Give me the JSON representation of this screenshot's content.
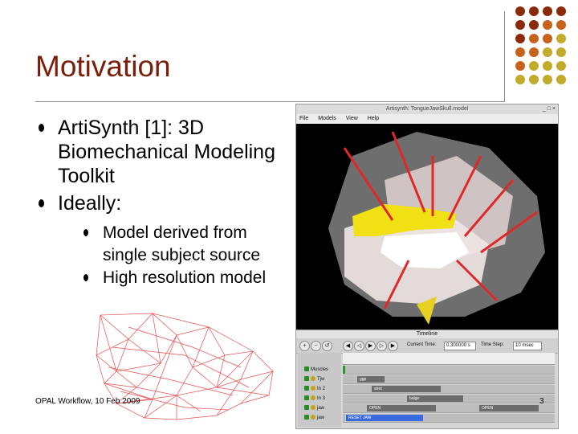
{
  "slide": {
    "title": "Motivation",
    "bullets": [
      {
        "text": "ArtiSynth [1]: 3D Biomechanical Modeling Toolkit"
      },
      {
        "text": "Ideally:",
        "sub": [
          "Model derived from single subject source",
          "High resolution model"
        ]
      }
    ],
    "footer": "OPAL Workflow, 10 Feb 2009",
    "page_number": "3"
  },
  "app_window": {
    "title": "Artisynth: TongueJawSkull.model",
    "menu": [
      "File",
      "Models",
      "View",
      "Help"
    ]
  },
  "timeline": {
    "title": "Timeline",
    "current_time_label": "Current Time:",
    "current_time_value": "0.300000 s",
    "time_step_label": "Time Step:",
    "time_step_value": "10 msec",
    "tracks": [
      "Muscles",
      "Tjw",
      "In 2",
      "In 3",
      "jaw",
      "jaw"
    ],
    "blocks": [
      "ggp",
      "stret",
      "bulge",
      "OPEN",
      "OPEN",
      "RESET JAW"
    ]
  },
  "colors": {
    "title": "#7a1f0a",
    "accent_dark": "#8b2a0a",
    "accent_orange": "#c8621a",
    "accent_olive": "#c2aa2a"
  }
}
